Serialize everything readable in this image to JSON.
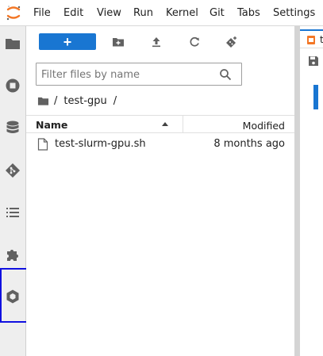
{
  "menu": {
    "items": [
      "File",
      "Edit",
      "View",
      "Run",
      "Kernel",
      "Git",
      "Tabs",
      "Settings"
    ]
  },
  "sidebar": {
    "icons": [
      "folder-icon",
      "running-icon",
      "database-icon",
      "git-icon",
      "toc-icon",
      "extension-icon",
      "hexagon-icon"
    ],
    "highlighted": "hexagon-icon"
  },
  "toolbar": {
    "new_label": "+"
  },
  "filter": {
    "placeholder": "Filter files by name",
    "value": ""
  },
  "breadcrumb": {
    "root_sep": "/",
    "folder": "test-gpu",
    "trail_sep": "/"
  },
  "file_list": {
    "columns": {
      "name": "Name",
      "modified": "Modified"
    },
    "rows": [
      {
        "name": "test-slurm-gpu.sh",
        "modified": "8 months ago"
      }
    ]
  },
  "right_panel": {
    "tab_title": "t"
  },
  "colors": {
    "accent": "#1976d2",
    "notebook_orange": "#f37726",
    "highlight_box": "#1010e0"
  }
}
